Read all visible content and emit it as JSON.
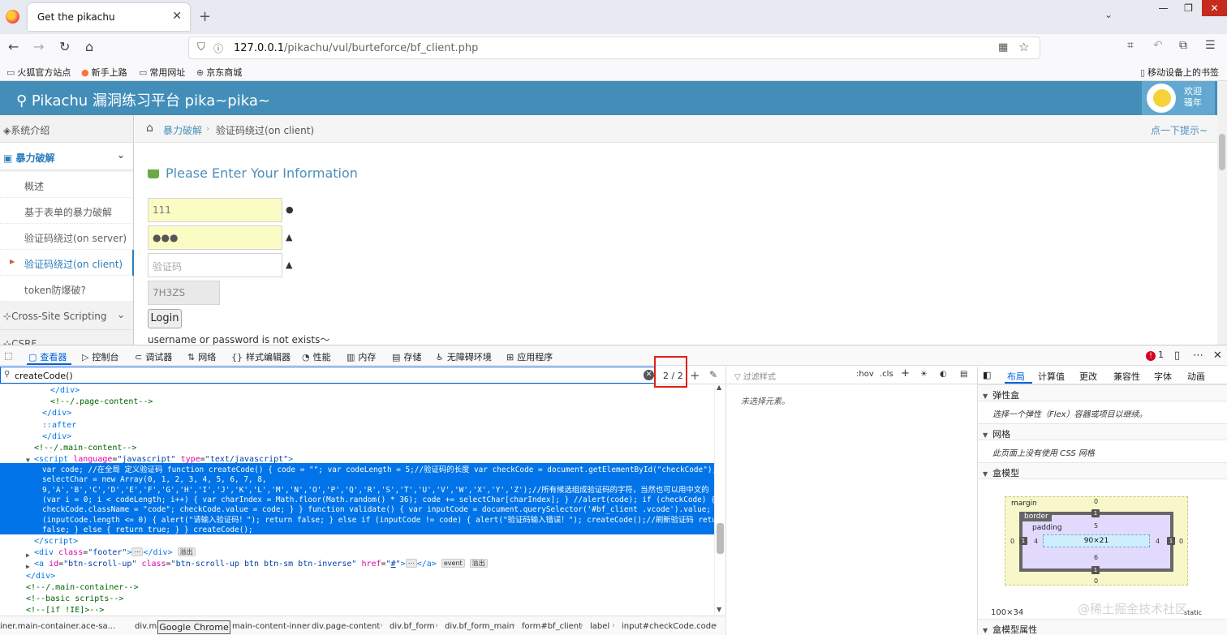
{
  "browser": {
    "tab_title": "Get the pikachu",
    "tab_close": "✕",
    "new_tab": "+",
    "url_host": "127.0.0.1",
    "url_path": "/pikachu/vul/burteforce/bf_client.php",
    "bookmarks": [
      "火狐官方站点",
      "新手上路",
      "常用网址",
      "京东商城"
    ],
    "mobile_bookmarks": "移动设备上的书签"
  },
  "site": {
    "brand": "Pikachu 漏洞练习平台 pika~pika~",
    "welcome_line1": "欢迎",
    "welcome_line2": "骚年"
  },
  "sidebar": {
    "top_items": [
      "系统介绍",
      "暴力破解",
      "Cross-Site Scripting",
      "CSRF"
    ],
    "sub_items": [
      "概述",
      "基于表单的暴力破解",
      "验证码绕过(on server)",
      "验证码绕过(on client)",
      "token防爆破?"
    ]
  },
  "breadcrumb": {
    "parent": "暴力破解",
    "current": "验证码绕过(on client)",
    "hint": "点一下提示~"
  },
  "form": {
    "title": "Please Enter Your Information",
    "username_value": "111",
    "password_value": "●●●",
    "captcha_placeholder": "验证码",
    "captcha_code": "7H3ZS",
    "login_label": "Login",
    "error_message": "username or password is not exists～"
  },
  "devtools": {
    "tabs": [
      "查看器",
      "控制台",
      "调试器",
      "网络",
      "样式编辑器",
      "性能",
      "内存",
      "存储",
      "无障碍环境",
      "应用程序"
    ],
    "error_count": "1",
    "search_value": "createCode()",
    "match_count": "2 / 2",
    "markup_lines": [
      {
        "indent": 62,
        "html": "<span class='tag'>&lt;/div&gt;</span>"
      },
      {
        "indent": 62,
        "html": "<span class='cmt'>&lt;!--/.page-content--&gt;</span>"
      },
      {
        "indent": 52,
        "html": "<span class='tag'>&lt;/div&gt;</span>"
      },
      {
        "indent": 52,
        "html": "<span class='pseudo'>::after</span>"
      },
      {
        "indent": 52,
        "html": "<span class='tag'>&lt;/div&gt;</span>"
      },
      {
        "indent": 42,
        "html": "<span class='cmt'>&lt;!--/.main-content--&gt;</span>"
      },
      {
        "indent": 42,
        "html": "<span class='tag'>&lt;script</span> <span class='attr'>language</span>=<span class='val'>\"javascript\"</span> <span class='attr'>type</span>=<span class='val'>\"text/javascript\"</span><span class='tag'>&gt;</span>"
      }
    ],
    "selected_script_lines": [
      "var code; //在全局 定义验证码 function createCode() { code = \"\"; var codeLength = 5;//验证码的长度 var checkCode = document.getElementById(\"checkCode\"); var",
      "selectChar = new Array(0, 1, 2, 3, 4, 5, 6, 7, 8,",
      "9,'A','B','C','D','E','F','G','H','I','J','K','L','M','N','O','P','Q','R','S','T','U','V','W','X','Y','Z');//所有候选组成验证码的字符，当然也可以用中文的 for",
      "(var i = 0; i < codeLength; i++) { var charIndex = Math.floor(Math.random() * 36); code += selectChar[charIndex]; } //alert(code); if (checkCode) {",
      "checkCode.className = \"code\"; checkCode.value = code; } } function validate() { var inputCode = document.querySelector('#bf_client .vcode').value; if",
      "(inputCode.length <= 0) { alert(\"请输入验证码！\"); return false; } else if (inputCode != code) { alert(\"验证码输入错误！\"); createCode();//刷新验证码 return",
      "false; } else { return true; } } createCode();"
    ],
    "markup_after": [
      {
        "indent": 42,
        "html": "<span class='tag'>&lt;/script&gt;</span>"
      },
      {
        "indent": 42,
        "html": "<span class='tag'>&lt;div</span> <span class='attr'>class</span>=<span class='val'>\"footer\"</span><span class='tag'>&gt;</span><span class='pill'>⋯</span><span class='tag'>&lt;/div&gt;</span> <span class='pill'>溢出</span>"
      },
      {
        "indent": 42,
        "html": "<span class='tag'>&lt;a</span> <span class='attr'>id</span>=<span class='val'>\"btn-scroll-up\"</span> <span class='attr'>class</span>=<span class='val'>\"btn-scroll-up btn btn-sm btn-inverse\"</span> <span class='attr'>href</span>=<span class='val'>\"<u>#</u>\"</span><span class='tag'>&gt;</span><span class='pill'>⋯</span><span class='tag'>&lt;/a&gt;</span> <span class='pill'>event</span> <span class='pill'>溢出</span>"
      },
      {
        "indent": 32,
        "html": "<span class='tag'>&lt;/div&gt;</span>"
      },
      {
        "indent": 32,
        "html": "<span class='cmt'>&lt;!--/.main-container--&gt;</span>"
      },
      {
        "indent": 32,
        "html": "<span class='cmt'>&lt;!--basic scripts--&gt;</span>"
      },
      {
        "indent": 32,
        "html": "<span class='cmt'>&lt;!--[if !IE]&gt;--&gt;</span>"
      }
    ],
    "node_breadcrumbs": [
      "iner.main-container.ace-sa...",
      "div.ma",
      "main-content-inner",
      "div.page-content",
      "div.bf_form",
      "div.bf_form_main",
      "form#bf_client",
      "label",
      "input#checkCode.code"
    ],
    "tooltip": "Google Chrome",
    "rules_filter_placeholder": "过滤样式",
    "rules_hov": ":hov",
    "rules_cls": ".cls",
    "rules_none": "未选择元素。",
    "layout_tabs": [
      "布局",
      "计算值",
      "更改",
      "兼容性",
      "字体",
      "动画"
    ],
    "flex_title": "弹性盒",
    "flex_body": "选择一个弹性（Flex）容器或项目以继续。",
    "grid_title": "网格",
    "grid_body": "此页面上没有使用 CSS 网格",
    "boxmodel_title": "盒模型",
    "boxmodel_props_title": "盒模型属性",
    "box": {
      "margin_label": "margin",
      "border_label": "border",
      "padding_label": "padding",
      "margin_top": "0",
      "margin_bottom": "0",
      "margin_left": "0",
      "margin_right": "0",
      "border_top": "1",
      "border_bottom": "1",
      "border_left": "1",
      "border_right": "1",
      "padding_top": "5",
      "padding_bottom": "6",
      "padding_left": "4",
      "padding_right": "4",
      "content": "90×21",
      "size": "100×34",
      "position": "static"
    },
    "watermark": "@稀土掘金技术社区"
  }
}
